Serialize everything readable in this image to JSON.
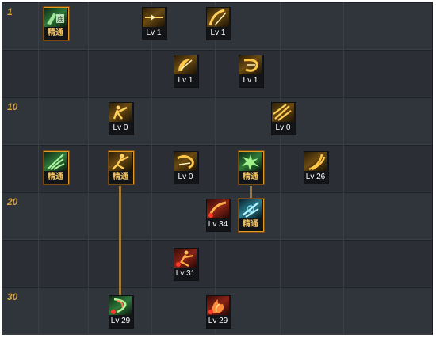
{
  "row_labels": [
    "1",
    "",
    "10",
    "",
    "20",
    "",
    "30"
  ],
  "skills": [
    {
      "icon": "base-skill-icon",
      "level": "精通",
      "mastered": true
    },
    {
      "icon": "sword-thrust-icon",
      "level": "Lv 1",
      "mastered": false
    },
    {
      "icon": "sword-slash-icon",
      "level": "Lv 1",
      "mastered": false
    },
    {
      "icon": "crescent-slash-icon",
      "level": "Lv 1",
      "mastered": false
    },
    {
      "icon": "whirl-slash-icon",
      "level": "Lv 1",
      "mastered": false
    },
    {
      "icon": "lunge-icon",
      "level": "Lv 0",
      "mastered": false
    },
    {
      "icon": "triple-blade-icon",
      "level": "Lv 0",
      "mastered": false
    },
    {
      "icon": "green-claw-icon",
      "level": "精通",
      "mastered": true
    },
    {
      "icon": "leap-strike-icon",
      "level": "精通",
      "mastered": true
    },
    {
      "icon": "spin-slash-icon",
      "level": "Lv 0",
      "mastered": false
    },
    {
      "icon": "green-burst-icon",
      "level": "精通",
      "mastered": true
    },
    {
      "icon": "wave-slash-icon",
      "level": "Lv 26",
      "mastered": false
    },
    {
      "icon": "red-slash-icon",
      "level": "Lv 34",
      "mastered": false
    },
    {
      "icon": "cyan-slash-icon",
      "level": "精通",
      "mastered": true
    },
    {
      "icon": "red-dash-icon",
      "level": "Lv 31",
      "mastered": false
    },
    {
      "icon": "green-tornado-icon",
      "level": "Lv 29",
      "mastered": false
    },
    {
      "icon": "red-flame-icon",
      "level": "Lv 29",
      "mastered": false
    }
  ]
}
